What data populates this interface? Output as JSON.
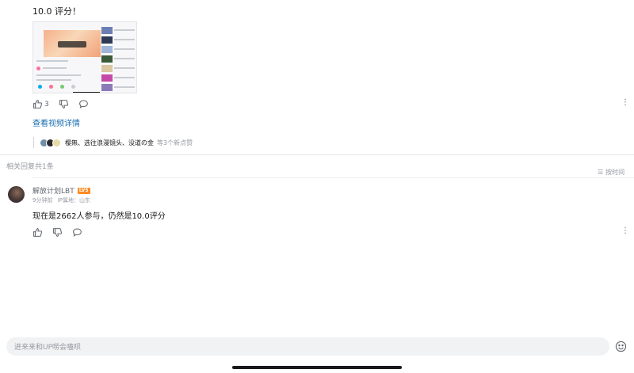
{
  "top_comment": {
    "text": "10.0 评分！",
    "like_count": "3",
    "view_video_link": "查看视频详情",
    "liked_by_names": "樱無、选往浪漫镜头、没道の金",
    "liked_by_suffix": "等3个新点赞"
  },
  "replies_section": {
    "count_text": "相关回复共1条",
    "sort_label": "按时间"
  },
  "reply": {
    "username": "解放计划LBT",
    "level_badge": "LV5",
    "time": "9分钟前",
    "ip_location": "IP属地：山东",
    "text": "现在是2662人参与，仍然是10.0评分"
  },
  "input_bar": {
    "placeholder": "进来来和UP唠会嗑呗"
  },
  "colors": {
    "link": "#1a6eb0",
    "level_badge": "#ff8a23",
    "secondary_text": "#9499a0"
  },
  "icons": [
    "thumb-up-icon",
    "thumb-down-icon",
    "comment-icon",
    "more-icon",
    "sort-icon",
    "emoji-icon"
  ]
}
